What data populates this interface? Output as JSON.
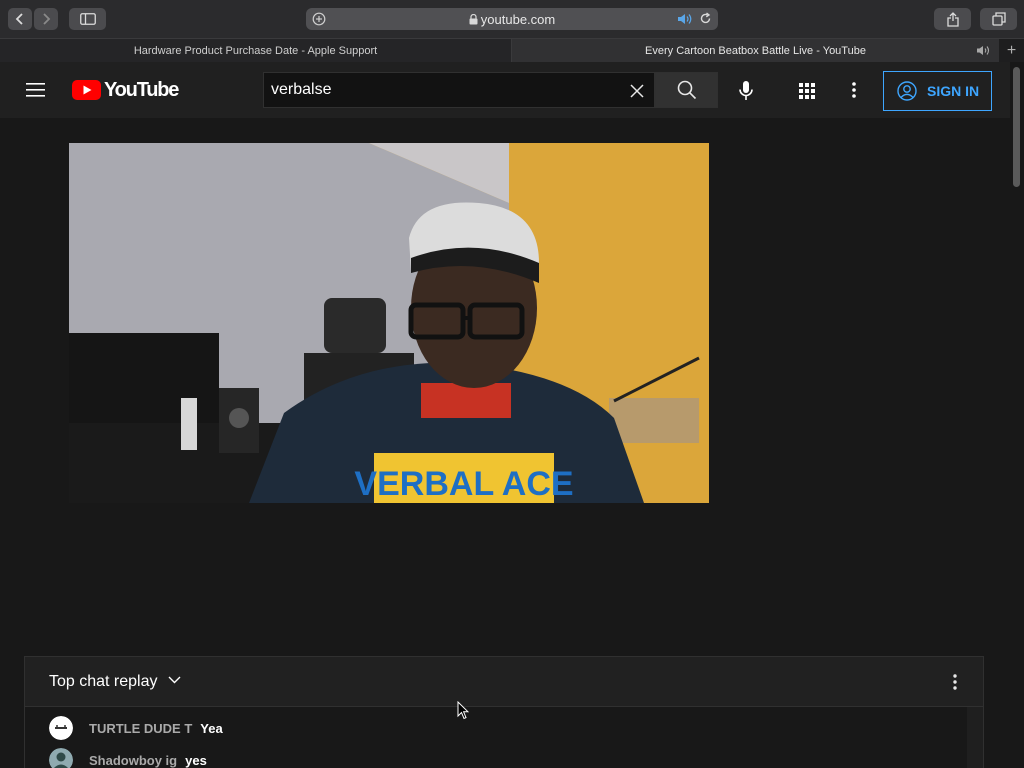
{
  "browser": {
    "address": "youtube.com",
    "tabs": [
      {
        "title": "Hardware Product Purchase Date - Apple Support"
      },
      {
        "title": "Every Cartoon Beatbox Battle Live - YouTube"
      }
    ]
  },
  "youtube": {
    "logo_text": "YouTube",
    "search_value": "verbalse",
    "sign_in_label": "SIGN IN",
    "accent": "#3ea6ff"
  },
  "video": {
    "shirt_text": "VERBAL ACE"
  },
  "chat": {
    "title": "Top chat replay",
    "messages": [
      {
        "author": "TURTLE DUDE T",
        "text": "Yea"
      },
      {
        "author": "Shadowboy ig",
        "text": "yes"
      }
    ]
  }
}
